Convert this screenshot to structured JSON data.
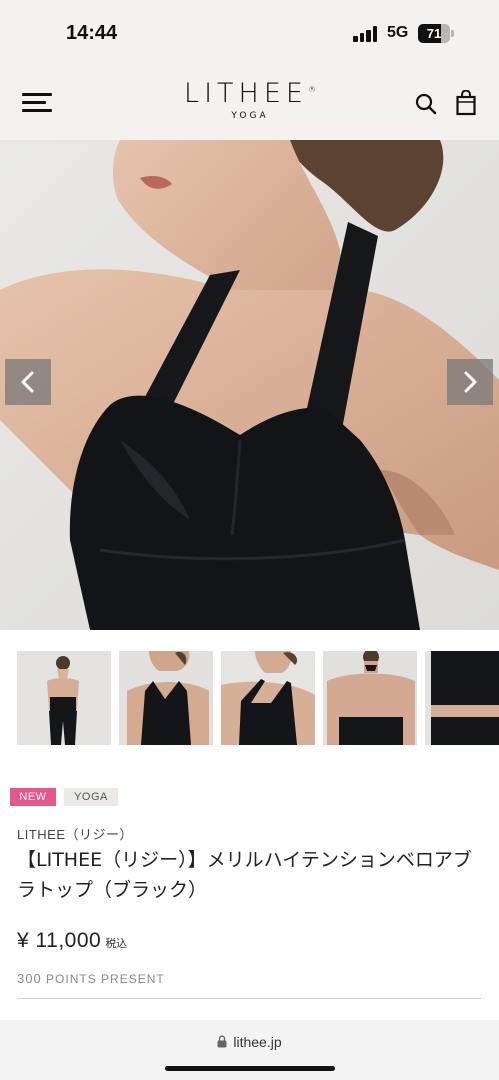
{
  "status_bar": {
    "time": "14:44",
    "network": "5G",
    "battery": "71",
    "battery_level": 0.71,
    "signal_bars": 4
  },
  "header": {
    "logo_text": "LITHEE",
    "logo_registered": "®",
    "logo_subtext": "YOGA",
    "icons": [
      "menu-icon",
      "search-icon",
      "shopping-bag-icon"
    ]
  },
  "gallery": {
    "prev_icon": "chevron-left-icon",
    "next_icon": "chevron-right-icon",
    "thumbnail_count": 5
  },
  "product": {
    "badges": [
      "NEW",
      "YOGA"
    ],
    "brand": "LITHEE（リジー）",
    "title": "【LITHEE（リジー）】メリルハイテンションベロアブラトップ（ブラック）",
    "price": "¥ 11,000",
    "tax_label": "税込",
    "points_number": "300",
    "points_label": "POINTS PRESENT"
  },
  "browser": {
    "url": "lithee.jp",
    "lock_icon": "lock-icon"
  },
  "colors": {
    "header_bg": "#f4f1ee",
    "new_badge": "#e6578b",
    "tag_badge": "#ece9e6",
    "garment": "#121418"
  }
}
